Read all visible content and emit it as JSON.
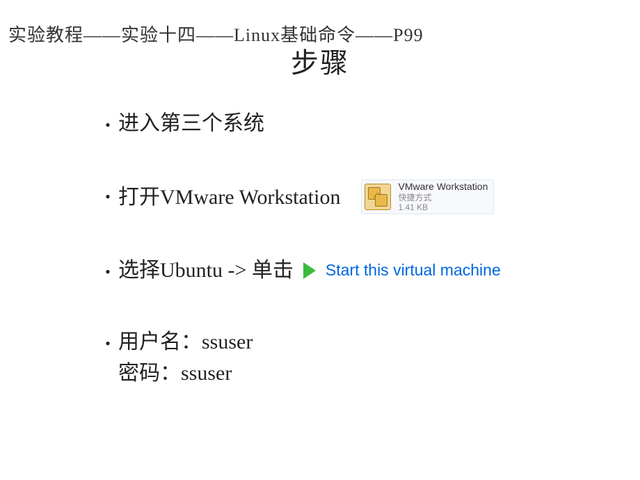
{
  "header": "实验教程——实验十四——Linux基础命令——P99",
  "title": "步骤",
  "bullets": {
    "item1": "进入第三个系统",
    "item2": "打开VMware Workstation",
    "item3": "选择Ubuntu  -> 单击",
    "item4_line1": "用户名：ssuser",
    "item4_line2": "密码：ssuser"
  },
  "shortcut": {
    "name": "VMware Workstation",
    "type": "快捷方式",
    "size": "1.41 KB"
  },
  "start_vm": {
    "label": "Start this virtual machine"
  }
}
